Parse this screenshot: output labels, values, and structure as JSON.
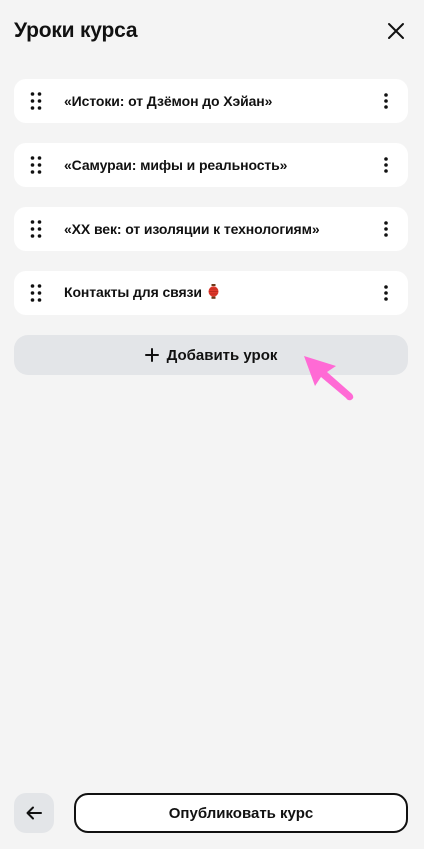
{
  "header": {
    "title": "Уроки курса",
    "close_icon": "close-icon"
  },
  "lessons": [
    {
      "title": "«Истоки: от Дзёмон до Хэйан»",
      "emoji": ""
    },
    {
      "title": "«Самураи: мифы и реальность»",
      "emoji": ""
    },
    {
      "title": "«XX век: от изоляции к технологиям»",
      "emoji": ""
    },
    {
      "title": "Контакты для связи",
      "emoji": "🏮"
    }
  ],
  "add_lesson": {
    "label": "Добавить урок",
    "icon": "plus-icon"
  },
  "footer": {
    "back_icon": "arrow-left-icon",
    "publish_label": "Опубликовать курс"
  },
  "colors": {
    "background": "#f4f4f4",
    "card": "#ffffff",
    "secondary_button": "#e3e5e8",
    "cursor": "#ff6ad5"
  }
}
